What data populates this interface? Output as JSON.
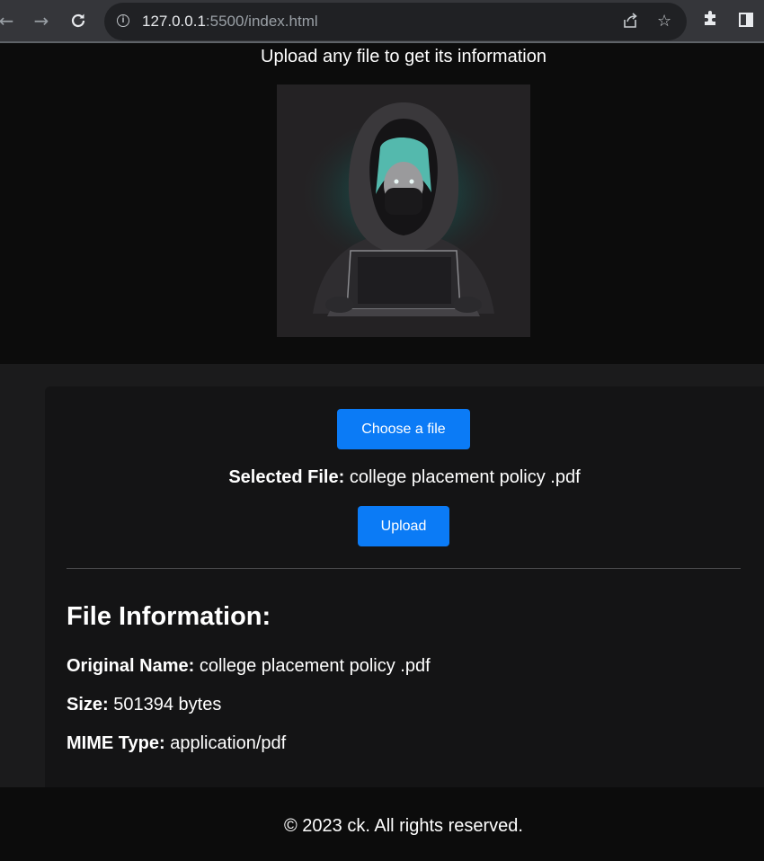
{
  "browser": {
    "url_host": "127.0.0.1",
    "url_rest": ":5500/index.html",
    "back_icon": "arrow-left-icon",
    "forward_icon": "arrow-right-icon",
    "reload_icon": "reload-icon",
    "info_icon": "info-icon",
    "share_icon": "share-icon",
    "star_icon": "star-icon",
    "extensions_icon": "puzzle-icon",
    "side_panel_icon": "side-panel-icon"
  },
  "header": {
    "title": "Upload any file to get its information",
    "image": "hooded-hacker-with-laptop-illustration"
  },
  "upload": {
    "choose_label": "Choose a file",
    "selected_label": "Selected File:",
    "selected_value": "college placement policy .pdf",
    "upload_label": "Upload"
  },
  "file_info": {
    "title": "File Information:",
    "name_label": "Original Name:",
    "name_value": "college placement policy .pdf",
    "size_label": "Size:",
    "size_value": "501394 bytes",
    "mime_label": "MIME Type:",
    "mime_value": "application/pdf"
  },
  "footer": {
    "text": "© 2023 ck. All rights reserved."
  },
  "colors": {
    "accent": "#0b7bf6",
    "page_bg": "#1b1b1c",
    "card_bg": "#141415",
    "header_bg": "#0c0c0c"
  }
}
